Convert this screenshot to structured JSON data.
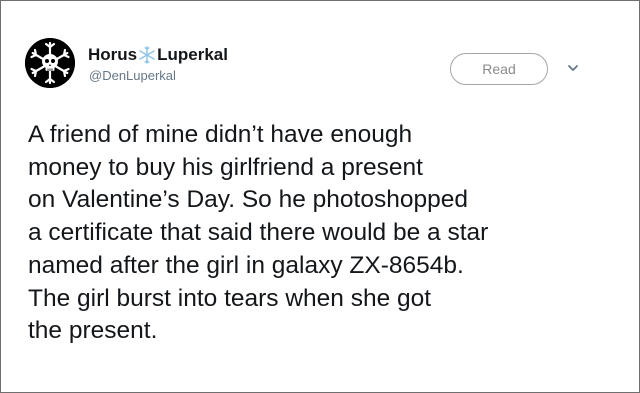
{
  "tweet": {
    "author": {
      "name_part1": "Horus",
      "name_part2": "Luperkal",
      "handle": "@DenLuperkal",
      "avatar_icon": "skull-crossbones-snowflake-icon",
      "name_icon": "snowflake-icon"
    },
    "read_button_label": "Read",
    "menu_icon": "chevron-down-icon",
    "text_lines": [
      "A friend of mine didn’t have enough",
      "money to buy his girlfriend a present",
      "on Valentine’s Day. So he photoshopped",
      "a certificate that said there would be a star",
      "named after the girl in galaxy ZX-8654b.",
      "The girl burst into tears when she got",
      "the present."
    ]
  },
  "colors": {
    "text": "#14171a",
    "secondary_text": "#657786",
    "snowflake": "#8fc4e8",
    "border": "#6f6f6f"
  }
}
